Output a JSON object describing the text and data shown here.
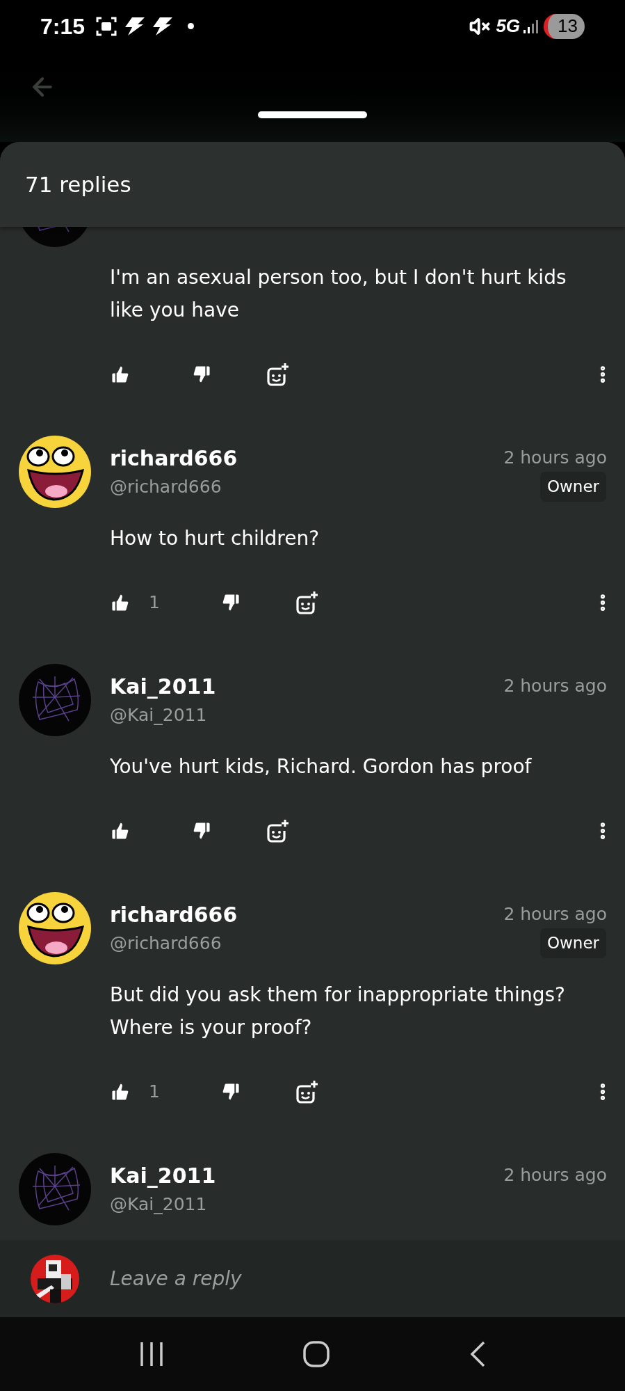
{
  "status_bar": {
    "time": "7:15",
    "network": "5G",
    "battery": "13"
  },
  "sheet": {
    "title": "71 replies"
  },
  "comments": [
    {
      "kind": "web",
      "body": "I'm an asexual person too, but I don't hurt kids like you have"
    },
    {
      "kind": "smiley",
      "name": "richard666",
      "handle": "@richard666",
      "time": "2 hours ago",
      "badge": "Owner",
      "body": "How to hurt children?",
      "likes": "1"
    },
    {
      "kind": "web",
      "name": "Kai_2011",
      "handle": "@Kai_2011",
      "time": "2 hours ago",
      "body": "You've hurt kids, Richard. Gordon has proof"
    },
    {
      "kind": "smiley",
      "name": "richard666",
      "handle": "@richard666",
      "time": "2 hours ago",
      "badge": "Owner",
      "body": "But did you ask them for inappropriate things? Where is your proof?",
      "likes": "1"
    },
    {
      "kind": "web",
      "name": "Kai_2011",
      "handle": "@Kai_2011",
      "time": "2 hours ago"
    }
  ],
  "reply_bar": {
    "placeholder": "Leave a reply"
  }
}
